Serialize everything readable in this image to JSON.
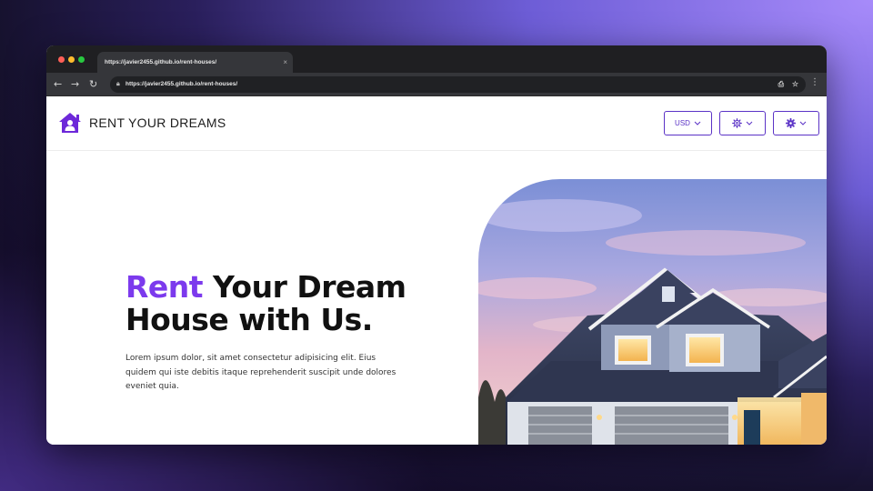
{
  "browser": {
    "tab_title": "https://javier2455.github.io/rent-houses/",
    "tab_close": "×",
    "url": "https://javier2455.github.io/rent-houses/"
  },
  "header": {
    "brand": "RENT YOUR DREAMS",
    "currency_label": "USD",
    "accent_color": "#5b33c6"
  },
  "hero": {
    "title_accent": "Rent",
    "title_rest_line1": " Your Dream",
    "title_line2": "House with Us.",
    "description": "Lorem ipsum dolor, sit amet consectetur adipisicing elit. Eius quidem qui iste debitis itaque reprehenderit suscipit unde dolores eveniet quia.",
    "accent_color": "#7c3aed"
  },
  "icons": [
    "back-icon",
    "forward-icon",
    "reload-icon",
    "lock-icon",
    "share-icon",
    "star-icon",
    "menu-dots-icon",
    "house-logo-icon",
    "chevron-down-icon",
    "light-gear-icon",
    "gear-icon"
  ]
}
